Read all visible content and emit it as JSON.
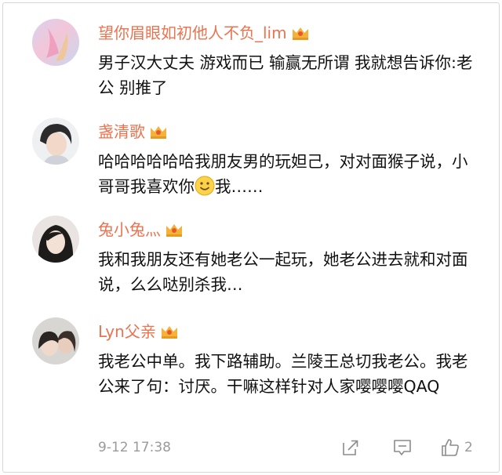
{
  "comments": [
    {
      "username": "望你眉眼如初他人不负_lim",
      "text": "男子汉大丈夫 游戏而已 输赢无所谓 我就想告诉你:老公 别推了"
    },
    {
      "username": "盏清歌",
      "text_before_emoji": "哈哈哈哈哈哈我朋友男的玩妲己，对对面猴子说，小哥哥我喜欢你",
      "text_after_emoji": "我……"
    },
    {
      "username": "兔小兔灬",
      "text": "我和我朋友还有她老公一起玩，她老公进去就和对面说，么么哒别杀我…"
    },
    {
      "username": "Lyn父亲",
      "text": "我老公中单。我下路辅助。兰陵王总切我老公。我老公来了句：讨厌。干嘛这样针对人家嘤嘤嘤QAQ"
    }
  ],
  "footer": {
    "timestamp": "9-12 17:38",
    "like_count": "2",
    "icons": [
      "share-icon",
      "comment-icon",
      "like-icon"
    ]
  },
  "colors": {
    "username": "#eb7350",
    "body_text": "#111111",
    "meta_text": "#9a9a9a",
    "badge": "#f4b23a"
  }
}
